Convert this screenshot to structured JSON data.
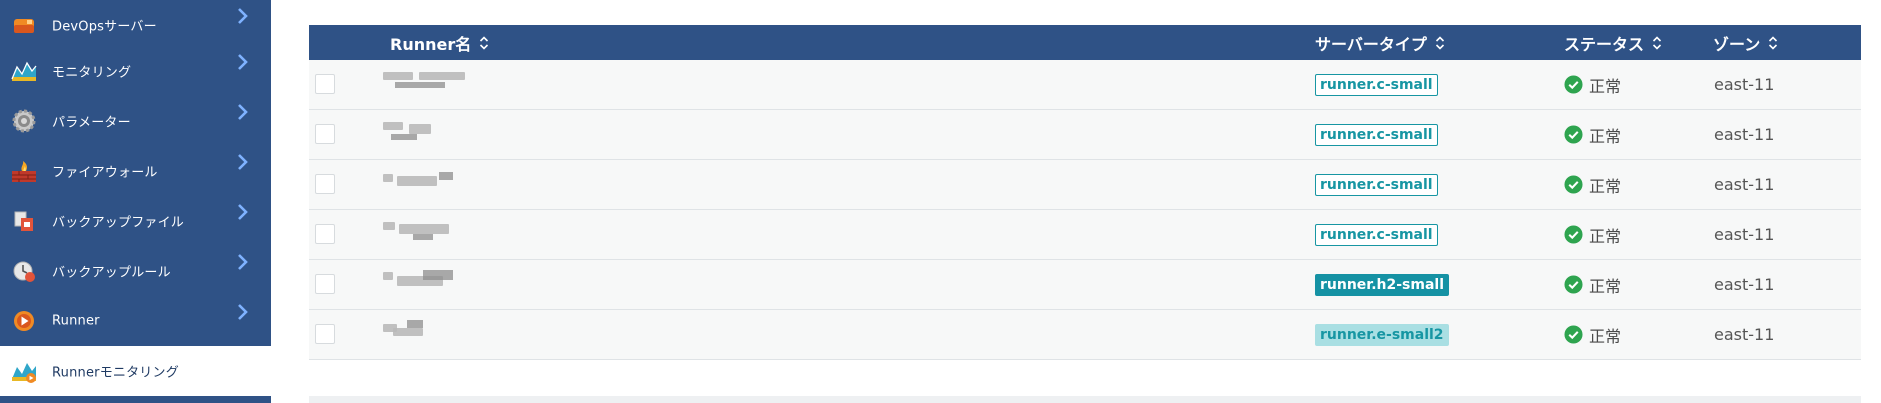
{
  "sidebar": {
    "items": [
      {
        "label": "DevOpsサーバー",
        "icon": "devops-server-icon",
        "active": false
      },
      {
        "label": "モニタリング",
        "icon": "monitoring-icon",
        "active": false
      },
      {
        "label": "パラメーター",
        "icon": "gear-icon",
        "active": false
      },
      {
        "label": "ファイアウォール",
        "icon": "firewall-icon",
        "active": false
      },
      {
        "label": "バックアップファイル",
        "icon": "backup-file-icon",
        "active": false
      },
      {
        "label": "バックアップルール",
        "icon": "backup-rule-icon",
        "active": false
      },
      {
        "label": "Runner",
        "icon": "runner-icon",
        "active": false
      },
      {
        "label": "Runnerモニタリング",
        "icon": "runner-monitoring-icon",
        "active": true
      }
    ]
  },
  "table": {
    "columns": {
      "name": "Runner名",
      "server_type": "サーバータイプ",
      "status": "ステータス",
      "zone": "ゾーン"
    },
    "rows": [
      {
        "server_type": "runner.c-small",
        "badge_style": "outline",
        "status": "正常",
        "zone": "east-11"
      },
      {
        "server_type": "runner.c-small",
        "badge_style": "outline",
        "status": "正常",
        "zone": "east-11"
      },
      {
        "server_type": "runner.c-small",
        "badge_style": "outline",
        "status": "正常",
        "zone": "east-11"
      },
      {
        "server_type": "runner.c-small",
        "badge_style": "outline",
        "status": "正常",
        "zone": "east-11"
      },
      {
        "server_type": "runner.h2-small",
        "badge_style": "solid",
        "status": "正常",
        "zone": "east-11"
      },
      {
        "server_type": "runner.e-small2",
        "badge_style": "light",
        "status": "正常",
        "zone": "east-11"
      }
    ]
  },
  "colors": {
    "sidebar_bg": "#2f5286",
    "header_bg": "#2f5286",
    "badge_teal": "#1796a3",
    "status_ok": "#2ea44f"
  }
}
